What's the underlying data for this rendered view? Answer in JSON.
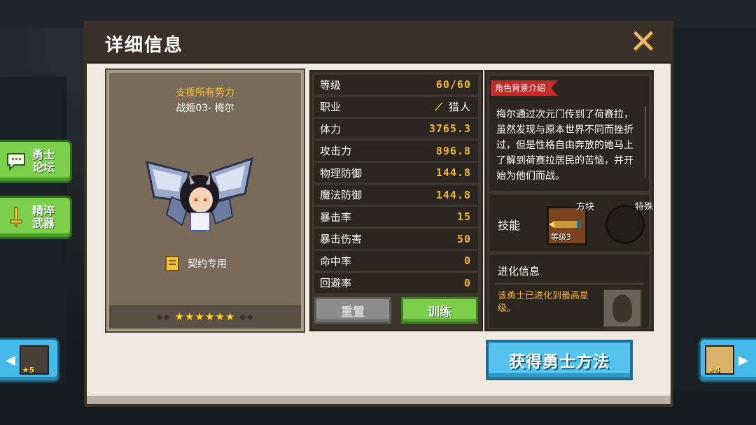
{
  "side_buttons": [
    {
      "label": "勇士论坛",
      "line1": "勇士",
      "line2": "论坛",
      "icon": "chat-bubble-icon"
    },
    {
      "label": "精淬武器",
      "line1": "精淬",
      "line2": "武器",
      "icon": "sword-icon"
    }
  ],
  "nav": {
    "prev_stars": "★5",
    "next_stars": "★4"
  },
  "dialog": {
    "title": "详细信息",
    "close_icon": "close-x-icon"
  },
  "hero": {
    "support_text": "支援所有势力",
    "name": "战姬03- 梅尔",
    "contract_label": "契约专用",
    "stars": "★★★★★★",
    "star_count": 6
  },
  "stats": [
    {
      "label": "等级",
      "value": "60/60"
    },
    {
      "label": "职业",
      "value": "猎人",
      "icon": "bow-icon"
    },
    {
      "label": "体力",
      "value": "3765.3"
    },
    {
      "label": "攻击力",
      "value": "896.8"
    },
    {
      "label": "物理防御",
      "value": "144.8"
    },
    {
      "label": "魔法防御",
      "value": "144.8"
    },
    {
      "label": "暴击率",
      "value": "15"
    },
    {
      "label": "暴击伤害",
      "value": "50"
    },
    {
      "label": "命中率",
      "value": "0"
    },
    {
      "label": "回避率",
      "value": "0"
    }
  ],
  "buttons": {
    "reset": "重置",
    "train": "训练",
    "obtain": "获得勇士方法"
  },
  "background": {
    "tag": "角色背景介绍",
    "text": "梅尔通过次元门传到了荷赛拉，虽然发现与原本世界不同而挫折过，但是性格自由奔放的她马上了解到荷赛拉居民的苦恼，并开始为他们而战。"
  },
  "skills": {
    "label": "技能",
    "slot1_tag": "方块",
    "slot1_level": "等级3",
    "slot2_tag": "特殊"
  },
  "evolution": {
    "heading": "进化信息",
    "message": "该勇士已进化到最高星级。"
  },
  "colors": {
    "accent_gold": "#f0b73a",
    "train_green": "#7ccf4a",
    "obtain_blue": "#55c3ee",
    "tag_red": "#c42b2b"
  }
}
